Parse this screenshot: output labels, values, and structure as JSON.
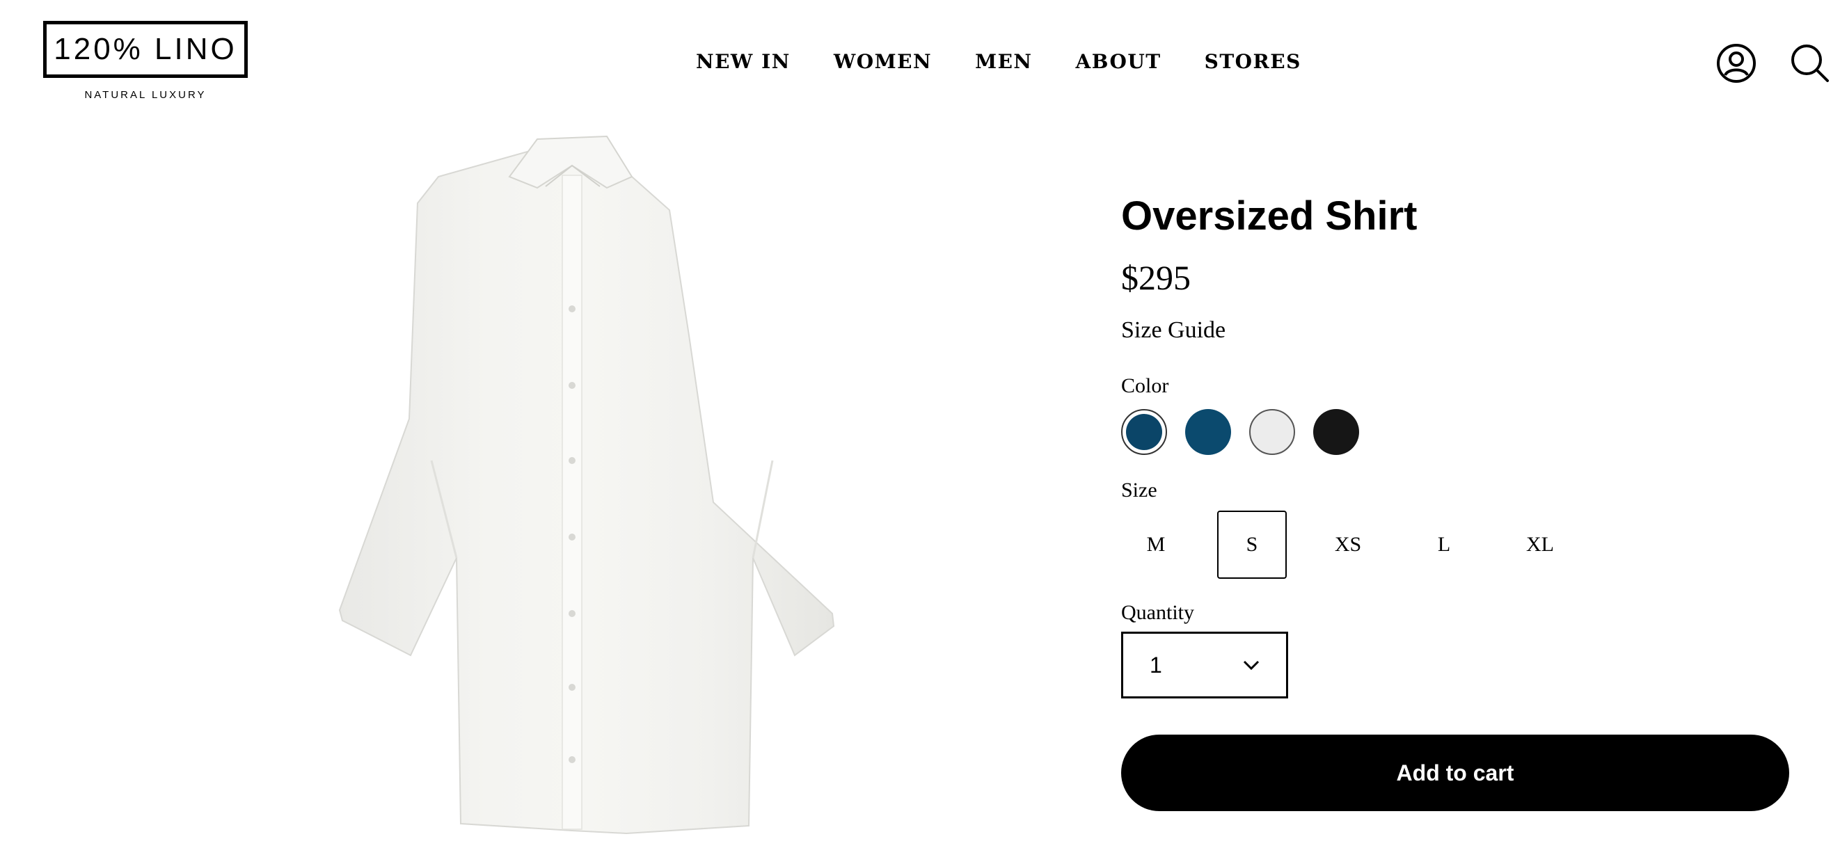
{
  "brand": {
    "logo_text": "120% LINO",
    "tagline": "NATURAL LUXURY"
  },
  "nav": {
    "items": [
      "NEW IN",
      "WOMEN",
      "MEN",
      "ABOUT",
      "STORES"
    ]
  },
  "header_icons": [
    "account-icon",
    "search-icon"
  ],
  "product": {
    "title": "Oversized Shirt",
    "price": "$295",
    "size_guide": "Size Guide",
    "color_label": "Color",
    "colors": [
      {
        "name": "deep-blue",
        "hex": "#0b4568",
        "selected": true
      },
      {
        "name": "deep-blue-2",
        "hex": "#0b4a6e",
        "selected": false
      },
      {
        "name": "white",
        "hex": "#ececec",
        "selected": false
      },
      {
        "name": "black",
        "hex": "#161616",
        "selected": false
      }
    ],
    "size_label": "Size",
    "sizes": [
      "M",
      "S",
      "XS",
      "L",
      "XL"
    ],
    "selected_size": "S",
    "quantity_label": "Quantity",
    "quantity_value": "1",
    "add_to_cart": "Add to cart"
  }
}
